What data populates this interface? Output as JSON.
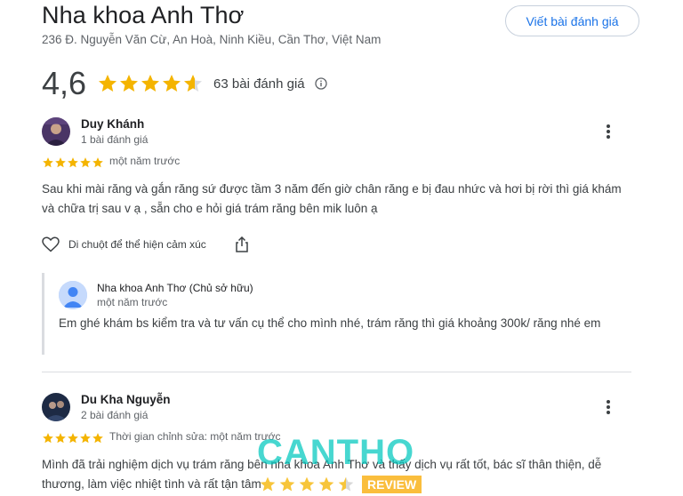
{
  "place": {
    "name": "Nha khoa Anh Thơ",
    "address": "236 Đ. Nguyễn Văn Cừ, An Hoà, Ninh Kiều, Cần Thơ, Việt Nam",
    "write_review_label": "Viết bài đánh giá"
  },
  "summary": {
    "rating": "4,6",
    "rating_numeric": 4.6,
    "review_count_label": "63 bài đánh giá",
    "star_color": "#f4b400",
    "star_empty_color": "#dadce0"
  },
  "reviews": [
    {
      "name": "Duy Khánh",
      "meta": "1 bài đánh giá",
      "stars": 5,
      "time": "một năm trước",
      "text": "Sau khi mài răng và gắn răng sứ được tầm 3 năm đến giờ chân răng e bị đau nhức và hơi bị rời thì giá khám và chữa trị sau v ạ , sẵn cho e hỏi giá trám răng bên mik luôn ạ",
      "like_label": "Di chuột để thể hiện cảm xúc",
      "owner_reply": {
        "name": "Nha khoa Anh Thơ (Chủ sở hữu)",
        "time": "một năm trước",
        "text": "Em ghé khám bs kiểm tra và tư vấn cụ thể cho mình nhé, trám răng thì giá khoảng 300k/ răng nhé em"
      }
    },
    {
      "name": "Du Kha Nguyễn",
      "meta": "2 bài đánh giá",
      "stars": 5,
      "time": "Thời gian chỉnh sửa: một năm trước",
      "text": "Mình đã trải nghiệm dịch vụ trám răng bên nha khoa Anh Thơ và thấy dịch vụ rất tốt, bác sĩ thân thiện, dễ thương, làm việc nhiệt tình và rất tận tâm"
    }
  ],
  "watermark": {
    "brand": "CANTHO",
    "badge": "REVIEW",
    "stars": 4.5
  },
  "icons": {
    "info": "info-icon",
    "more": "more-vert-icon",
    "like": "heart-outline-icon",
    "share": "share-icon"
  }
}
